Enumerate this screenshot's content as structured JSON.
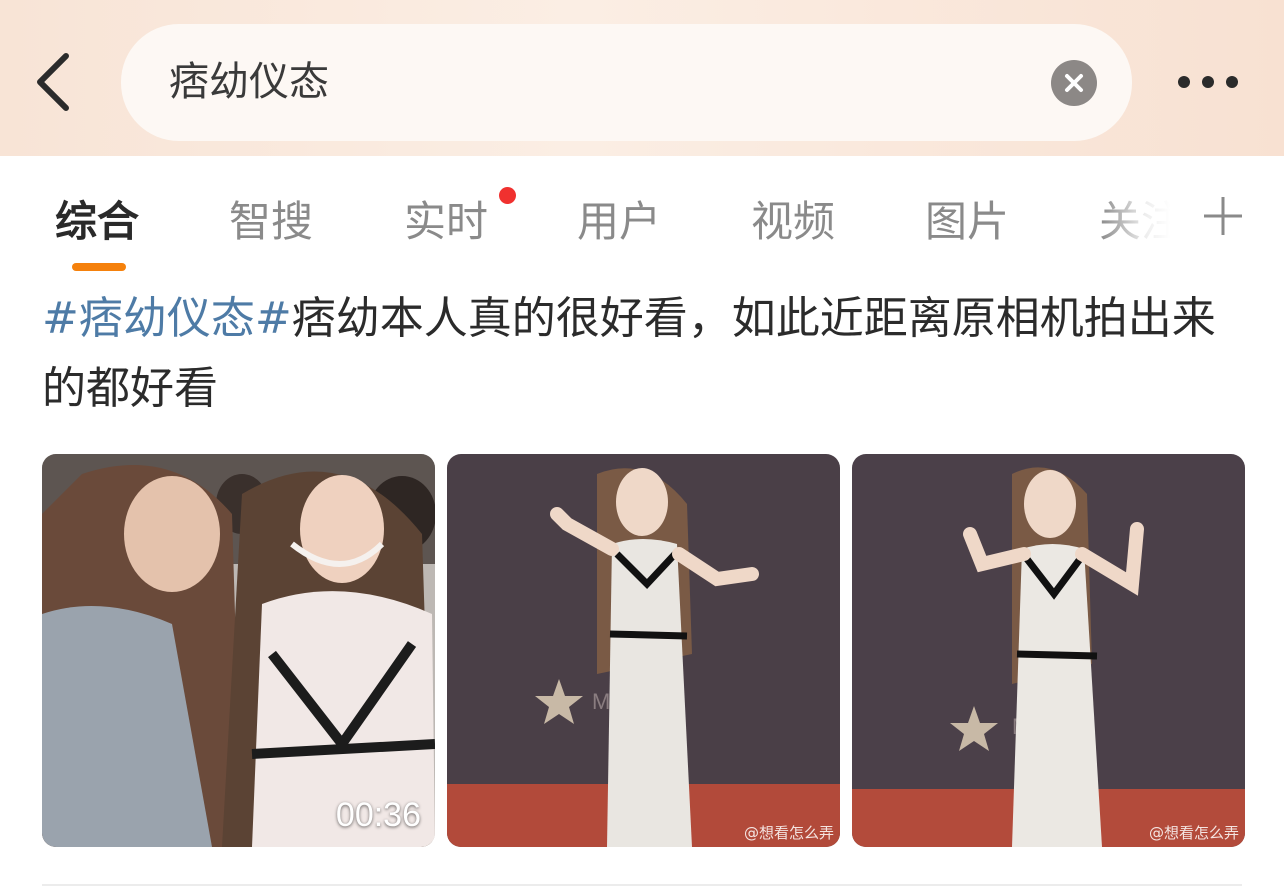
{
  "search": {
    "query": "痞幼仪态"
  },
  "header": {
    "back_icon": "chevron-left-icon",
    "clear_icon": "close-circle-icon",
    "more_icon": "more-horizontal-icon"
  },
  "tabs": {
    "items": [
      {
        "label": "综合",
        "active": true
      },
      {
        "label": "智搜"
      },
      {
        "label": "实时",
        "has_dot": true
      },
      {
        "label": "用户"
      },
      {
        "label": "视频"
      },
      {
        "label": "图片"
      },
      {
        "label": "关注"
      }
    ],
    "plus_icon": "plus-icon",
    "accent_color": "#f5810c",
    "dot_color": "#f0312f"
  },
  "post": {
    "hashtag": "#痞幼仪态#",
    "text": "痞幼本人真的很好看，如此近距离原相机拍出来的都好看",
    "hashtag_color": "#4e7ba6",
    "media": [
      {
        "type": "video",
        "duration": "00:36"
      },
      {
        "type": "image",
        "watermark": "@想看怎么弄"
      },
      {
        "type": "image",
        "watermark": "@想看怎么弄"
      }
    ]
  }
}
